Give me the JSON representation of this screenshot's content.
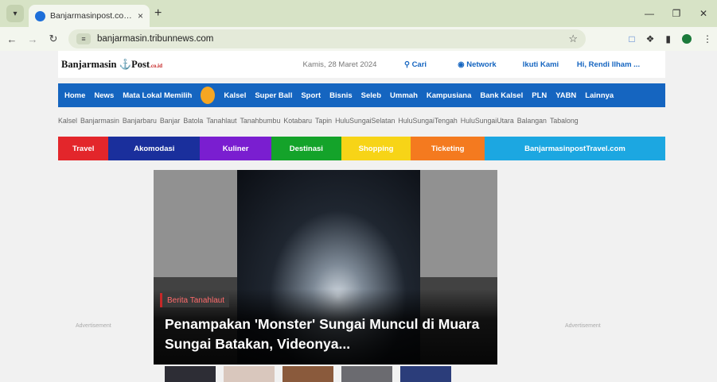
{
  "browser": {
    "tab_title": "Banjarmasinpost.co.id - Berita",
    "tab_close": "×",
    "new_tab": "+",
    "url": "banjarmasin.tribunnews.com",
    "icons": [
      "chevron-down-icon",
      "back-icon",
      "forward-icon",
      "reload-icon",
      "site-info-icon",
      "star-icon",
      "extension-icon",
      "sidebar-icon",
      "profile-icon",
      "menu-icon",
      "minimize-icon",
      "restore-icon",
      "close-icon"
    ]
  },
  "site_header": {
    "logo": "Banjarmasin",
    "logo_post": "Post",
    "logo_suffix": ".co.id",
    "date": "Kamis, 28 Maret 2024",
    "search": "Cari",
    "network": "Network",
    "follow": "Ikuti Kami",
    "user": "Hi, Rendi Ilham ..."
  },
  "main_nav": [
    "Home",
    "News",
    "Mata Lokal Memilih",
    "Kalsel",
    "Super Ball",
    "Sport",
    "Bisnis",
    "Seleb",
    "Ummah",
    "Kampusiana",
    "Bank Kalsel",
    "PLN",
    "YABN",
    "Lainnya"
  ],
  "sub_nav": [
    "Kalsel",
    "Banjarmasin",
    "Banjarbaru",
    "Banjar",
    "Batola",
    "Tanahlaut",
    "Tanahbumbu",
    "Kotabaru",
    "Tapin",
    "HuluSungaiSelatan",
    "HuluSungaiTengah",
    "HuluSungaiUtara",
    "Balangan",
    "Tabalong"
  ],
  "categories": [
    {
      "label": "Travel",
      "color": "#e3262b"
    },
    {
      "label": "Akomodasi",
      "color": "#1a2f9c"
    },
    {
      "label": "Kuliner",
      "color": "#7a1ed0"
    },
    {
      "label": "Destinasi",
      "color": "#14a32a"
    },
    {
      "label": "Shopping",
      "color": "#f7d417"
    },
    {
      "label": "Ticketing",
      "color": "#f47a1f"
    },
    {
      "label": "BanjarmasinpostTravel.com",
      "color": "#1ca7e1"
    }
  ],
  "ads": {
    "left": "Advertisement",
    "right": "Advertisement"
  },
  "hero": {
    "tag": "Berita Tanahlaut",
    "title": "Penampakan 'Monster' Sungai Muncul di Muara Sungai Batakan, Videonya..."
  }
}
